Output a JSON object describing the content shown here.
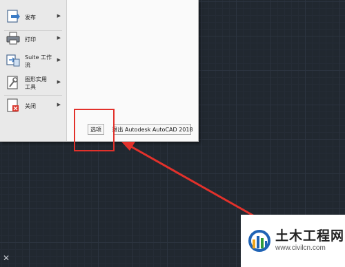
{
  "app_menu": {
    "items": [
      {
        "label": "发布",
        "icon": "publish-icon",
        "submenu": true
      },
      {
        "label": "打印",
        "icon": "printer-icon",
        "submenu": true
      },
      {
        "label": "Suite 工作\n流",
        "icon": "suite-workflow-icon",
        "submenu": true
      },
      {
        "label": "图形实用\n工具",
        "icon": "drawing-utilities-icon",
        "submenu": true
      },
      {
        "label": "关闭",
        "icon": "close-document-icon",
        "submenu": true
      }
    ],
    "options_button": "选项",
    "exit_button": "退出 Autodesk AutoCAD 2018"
  },
  "colors": {
    "canvas_bg": "#212830",
    "annotation_red": "#e2312b",
    "menu_bg": "#f4f4f4"
  },
  "watermark": {
    "name": "土木工程网",
    "url": "www.civilcn.com"
  },
  "canvas": {
    "ucs_glyph": "✕"
  }
}
